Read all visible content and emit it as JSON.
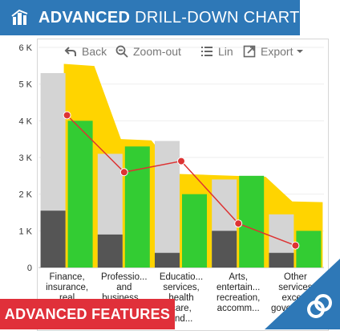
{
  "banner": {
    "bold": "ADVANCED",
    "rest": " DRILL-DOWN CHART",
    "icon": "building-chart-icon"
  },
  "toolbar": {
    "back_label": "Back",
    "zoom_out_label": "Zoom-out",
    "lin_label": "Lin",
    "export_label": "Export"
  },
  "footer": {
    "label": "ADVANCED FEATURES"
  },
  "colors": {
    "banner": "#2e78b7",
    "area": "#ffd400",
    "gray_light": "#d4d4d4",
    "gray_dark": "#555555",
    "green": "#33cc33",
    "line": "#dd3333",
    "footer": "#e0303a"
  },
  "chart_data": {
    "type": "bar",
    "categories": [
      "Finance, insurance, real estate...",
      "Professio... and business...",
      "Educatio... services, health care, and...",
      "Arts, entertain... recreation, accomm...",
      "Other services except government"
    ],
    "y_ticks": [
      "0",
      "1 K",
      "2 K",
      "3 K",
      "4 K",
      "5 K",
      "6 K"
    ],
    "ylim": [
      0,
      6000
    ],
    "series": [
      {
        "kind": "bar",
        "values": [
          5300,
          3100,
          3450,
          2400,
          1450
        ]
      },
      {
        "kind": "bar",
        "values": [
          1550,
          900,
          400,
          1000,
          400
        ]
      },
      {
        "kind": "bar",
        "values": [
          4000,
          3300,
          2000,
          2500,
          1000
        ]
      },
      {
        "kind": "line",
        "values": [
          4150,
          2600,
          2900,
          1200,
          600
        ]
      },
      {
        "kind": "area",
        "values": [
          5550,
          3500,
          2550,
          2500,
          1800
        ]
      }
    ]
  }
}
